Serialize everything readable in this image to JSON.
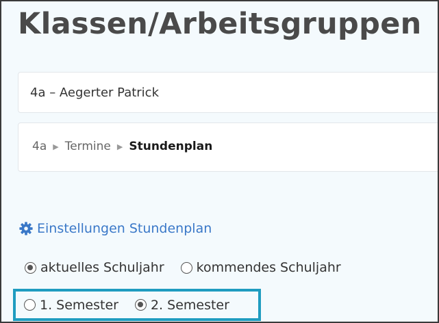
{
  "page": {
    "title": "Klassen/Arbeitsgruppen"
  },
  "class_card": {
    "name": "4a – Aegerter Patrick"
  },
  "breadcrumb": {
    "items": [
      "4a",
      "Termine"
    ],
    "separator_icon": "triangle-right-icon",
    "current": "Stundenplan"
  },
  "settings": {
    "icon": "gear-icon",
    "label": "Einstellungen Stundenplan",
    "color": "#3a78c8"
  },
  "school_year": {
    "options": [
      {
        "label": "aktuelles Schuljahr",
        "selected": true
      },
      {
        "label": "kommendes Schuljahr",
        "selected": false
      }
    ]
  },
  "semester": {
    "highlight_color": "#1f9cc0",
    "options": [
      {
        "label": "1. Semester",
        "selected": false
      },
      {
        "label": "2. Semester",
        "selected": true
      }
    ]
  }
}
